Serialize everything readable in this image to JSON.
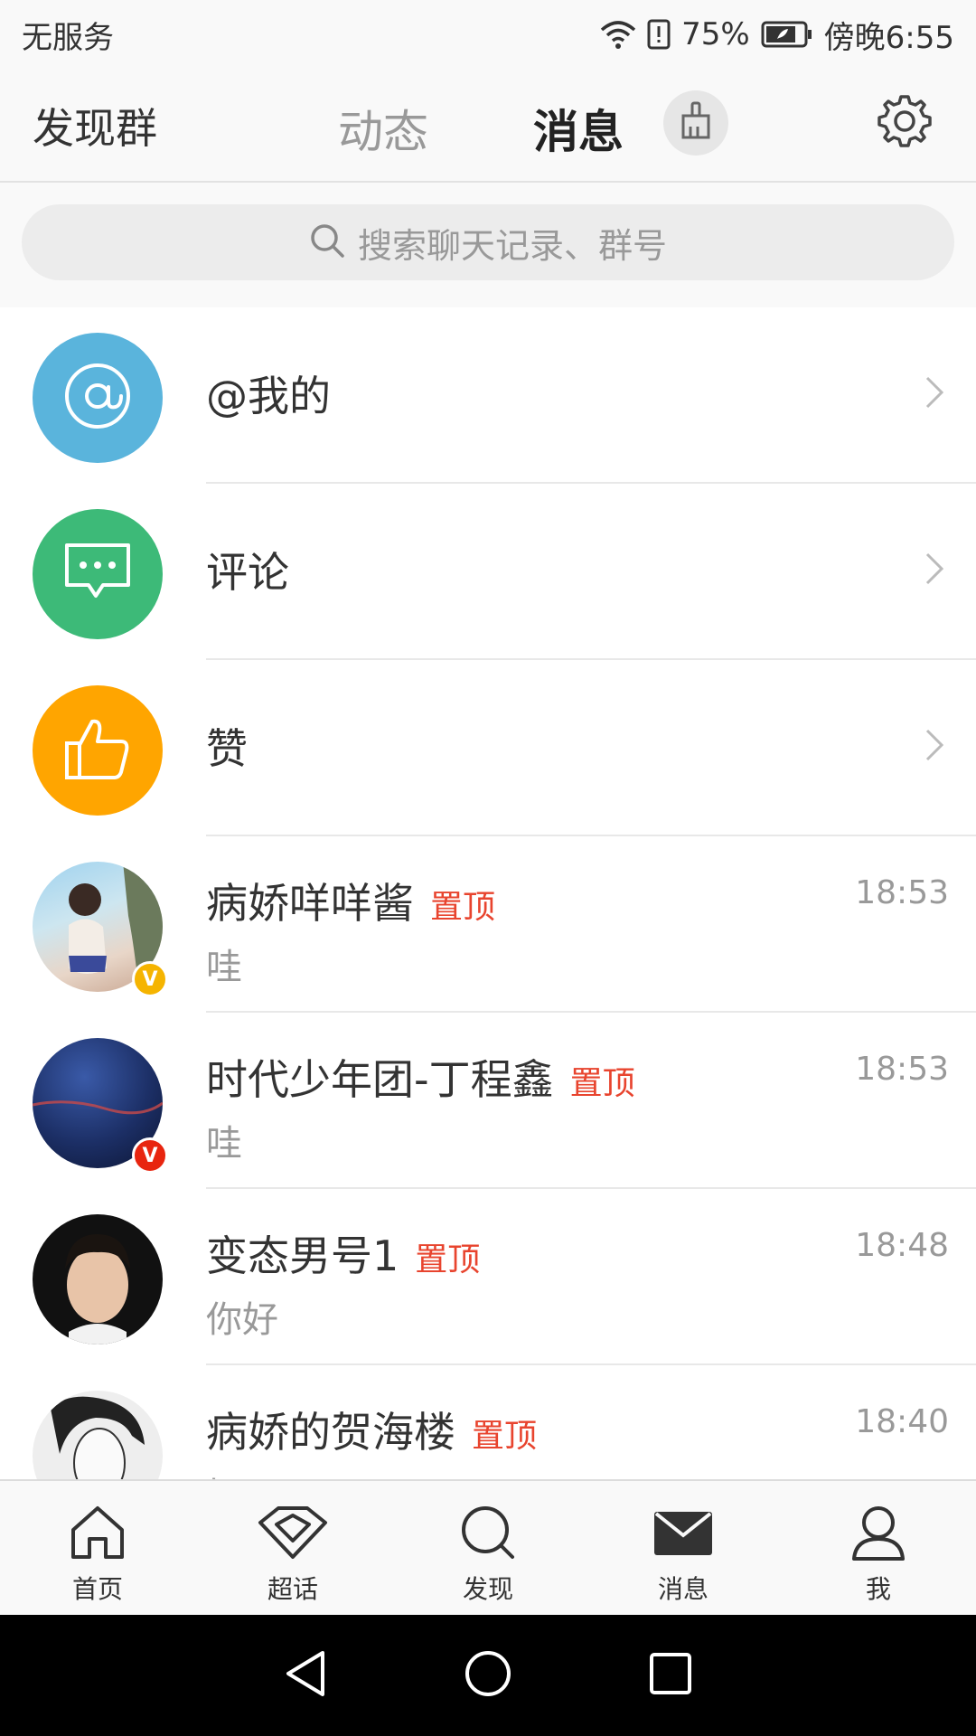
{
  "status_bar": {
    "carrier": "无服务",
    "battery": "75%",
    "time": "傍晚6:55"
  },
  "top_nav": {
    "left_label": "发现群",
    "tabs": [
      {
        "label": "动态",
        "active": false
      },
      {
        "label": "消息",
        "active": true
      }
    ],
    "clear_icon": "broom-icon",
    "settings_icon": "gear-icon"
  },
  "search": {
    "placeholder": "搜索聊天记录、群号"
  },
  "notification_rows": [
    {
      "label": "@我的",
      "icon": "at-icon",
      "color": "#5ab4dc"
    },
    {
      "label": "评论",
      "icon": "comment-icon",
      "color": "#3dba78"
    },
    {
      "label": "赞",
      "icon": "thumbs-up-icon",
      "color": "#ffa500"
    }
  ],
  "chats": [
    {
      "name": "病娇咩咩酱",
      "pin": "置顶",
      "time": "18:53",
      "preview": "哇",
      "badge": "V",
      "badge_color": "#f5b400"
    },
    {
      "name": "时代少年团-丁程鑫",
      "pin": "置顶",
      "time": "18:53",
      "preview": "哇",
      "badge": "V",
      "badge_color": "#e8250f"
    },
    {
      "name": "变态男号1",
      "pin": "置顶",
      "time": "18:48",
      "preview": "你好",
      "badge": "",
      "badge_color": ""
    },
    {
      "name": "病娇的贺海楼",
      "pin": "置顶",
      "time": "18:40",
      "preview": "好",
      "badge": "",
      "badge_color": ""
    }
  ],
  "bottom_tabs": [
    {
      "label": "首页",
      "icon": "home-icon"
    },
    {
      "label": "超话",
      "icon": "diamond-icon"
    },
    {
      "label": "发现",
      "icon": "search-icon"
    },
    {
      "label": "消息",
      "icon": "mail-icon"
    },
    {
      "label": "我",
      "icon": "profile-icon"
    }
  ],
  "colors": {
    "accent": "#f5a623",
    "pin_red": "#e8442e"
  }
}
